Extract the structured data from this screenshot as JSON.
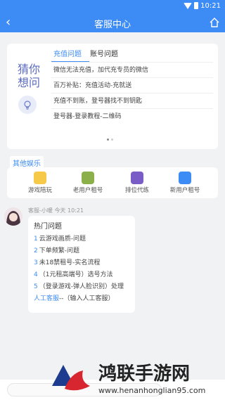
{
  "status": {
    "time": "10:21"
  },
  "nav": {
    "title": "客服中心"
  },
  "faq": {
    "guess_line1": "猜你",
    "guess_line2": "想问",
    "tabs": [
      "充值问题",
      "账号问题"
    ],
    "items": [
      "微信无法充值，加代充专员的微信",
      "百万补贴：充值活动-充就送",
      "充值不到账，登号器找不到钥匙",
      "登号器-登录教程-二维码"
    ]
  },
  "other": {
    "label": "其他娱乐",
    "items": [
      {
        "label": "游戏陪玩",
        "color": "#f7c948"
      },
      {
        "label": "老用户租号",
        "color": "#8bb04a"
      },
      {
        "label": "排位代练",
        "color": "#7a5cc6"
      },
      {
        "label": "新用户租号",
        "color": "#3d8bf5"
      }
    ]
  },
  "chat": {
    "agent": "客服-小暖",
    "time": "今天 10:21",
    "hot_title": "热门问题",
    "questions": [
      {
        "num": "1",
        "text": "云游戏画质-问题"
      },
      {
        "num": "2",
        "text": "下单频繁-问题"
      },
      {
        "num": "3",
        "text": "未18禁租号-实名流程"
      },
      {
        "num": "4",
        "text": "（1元租高端号）选号方法"
      },
      {
        "num": "5",
        "text": "（登录游戏-弹人脸识别）处理"
      }
    ],
    "manual_link": "人工客服",
    "manual_hint": "--（输入人工客服）"
  },
  "watermark": {
    "title": "鸿联手游网",
    "url": "www.henanhonglian95.com"
  },
  "colors": {
    "brand": "#3d8bf5"
  }
}
